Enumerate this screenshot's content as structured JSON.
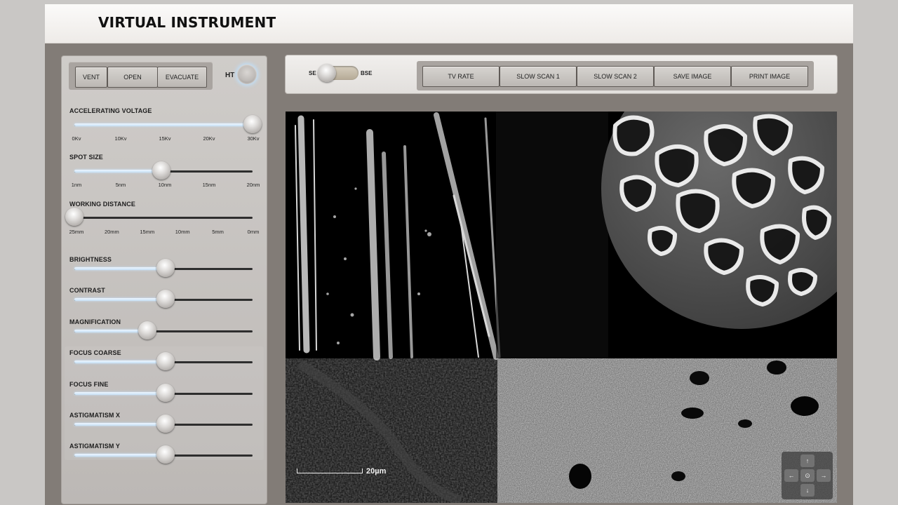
{
  "app": {
    "title": "VIRTUAL INSTRUMENT"
  },
  "vacuum": {
    "buttons": [
      "VENT",
      "OPEN",
      "EVACUATE"
    ],
    "ht_label": "HT"
  },
  "detector": {
    "se_label": "SE",
    "bse_label": "BSE",
    "selected": "SE"
  },
  "scan_buttons": [
    "TV RATE",
    "SLOW SCAN 1",
    "SLOW SCAN 2",
    "SAVE IMAGE",
    "PRINT IMAGE"
  ],
  "sliders": {
    "accelerating_voltage": {
      "label": "ACCELERATING VOLTAGE",
      "value": 1.0,
      "ticks": [
        "0Kv",
        "10Kv",
        "15Kv",
        "20Kv",
        "30Kv"
      ]
    },
    "spot_size": {
      "label": "SPOT SIZE",
      "value": 0.49,
      "ticks": [
        "1nm",
        "5nm",
        "10nm",
        "15nm",
        "20nm"
      ]
    },
    "working_distance": {
      "label": "WORKING DISTANCE",
      "value": 0.0,
      "ticks": [
        "25mm",
        "20mm",
        "15mm",
        "10mm",
        "5mm",
        "0mm"
      ]
    },
    "brightness": {
      "label": "BRIGHTNESS",
      "value": 0.51
    },
    "contrast": {
      "label": "CONTRAST",
      "value": 0.51
    },
    "magnification": {
      "label": "MAGNIFICATION",
      "value": 0.41
    },
    "focus_coarse": {
      "label": "FOCUS COARSE",
      "value": 0.51
    },
    "focus_fine": {
      "label": "FOCUS FINE",
      "value": 0.51
    },
    "astigmatism_x": {
      "label": "ASTIGMATISM X",
      "value": 0.51
    },
    "astigmatism_y": {
      "label": "ASTIGMATISM Y",
      "value": 0.51
    }
  },
  "viewer": {
    "scale_label": "20µm",
    "nav": {
      "up": "↑",
      "down": "↓",
      "left": "←",
      "right": "→",
      "center": "⊙"
    }
  },
  "colors": {
    "panel": "#c7c4c1",
    "frame": "#827c77",
    "slider_fill": "#d6ebfa"
  }
}
